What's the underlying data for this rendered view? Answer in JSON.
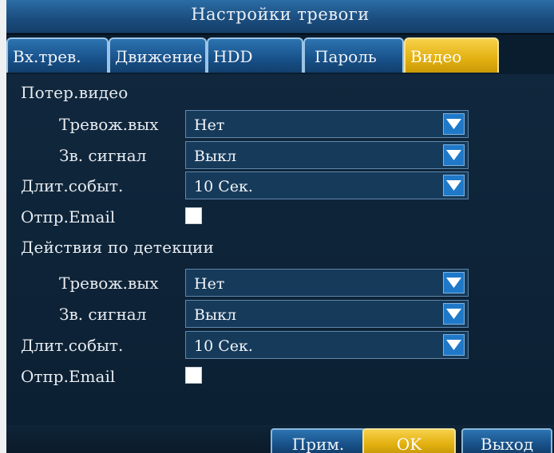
{
  "window": {
    "title": "Настройки тревоги"
  },
  "tabs": [
    {
      "label": "Вх.трев.",
      "active": false
    },
    {
      "label": "Движение",
      "active": false
    },
    {
      "label": "HDD",
      "active": false
    },
    {
      "label": "Пароль",
      "active": false
    },
    {
      "label": "Видео",
      "active": true
    }
  ],
  "video_loss": {
    "heading": "Потер.видео",
    "alarm_out_label": "Тревож.вых",
    "alarm_out_value": "Нет",
    "buzzer_label": "Зв. сигнал",
    "buzzer_value": "Выкл",
    "duration_label": "Длит.событ.",
    "duration_value": "10 Сек.",
    "email_label": "Отпр.Email",
    "email_checked": false
  },
  "detection": {
    "heading": "Действия по детекции",
    "alarm_out_label": "Тревож.вых",
    "alarm_out_value": "Нет",
    "buzzer_label": "Зв. сигнал",
    "buzzer_value": "Выкл",
    "duration_label": "Длит.событ.",
    "duration_value": "10 Сек.",
    "email_label": "Отпр.Email",
    "email_checked": false
  },
  "footer": {
    "apply_label": "Прим.",
    "ok_label": "OK",
    "exit_label": "Выход"
  },
  "colors": {
    "tab_active": "#e2b010",
    "tab_inactive": "#18518a",
    "dropdown_arrow": "#1f79c8",
    "background": "#0c2033"
  }
}
